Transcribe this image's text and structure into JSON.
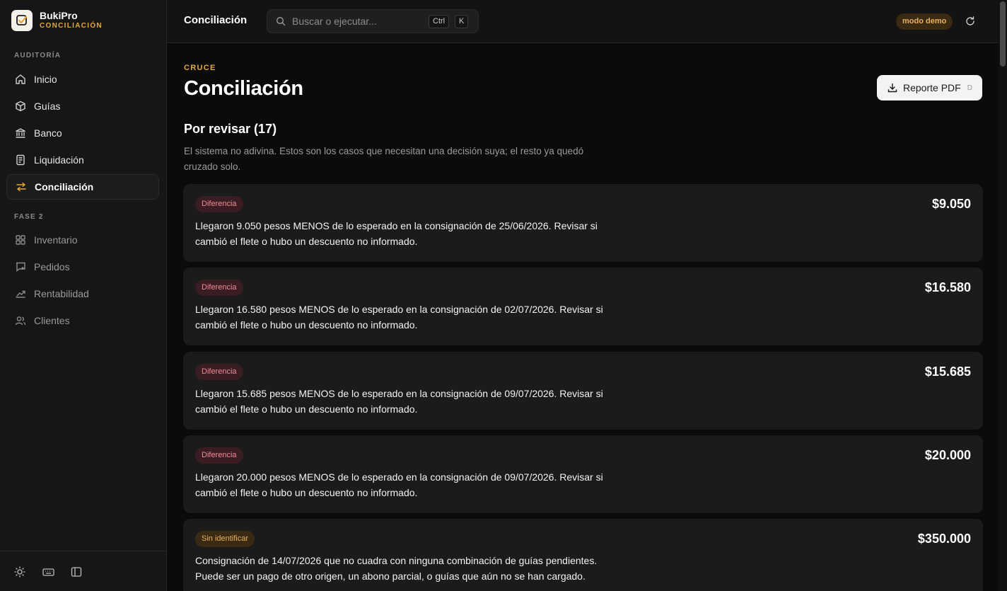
{
  "brand": {
    "name": "BukiPro",
    "subtitle": "CONCILIACIÓN"
  },
  "sidebar": {
    "sections": [
      {
        "label": "AUDITORÍA",
        "items": [
          {
            "label": "Inicio",
            "icon": "home-icon"
          },
          {
            "label": "Guías",
            "icon": "package-icon"
          },
          {
            "label": "Banco",
            "icon": "bank-icon"
          },
          {
            "label": "Liquidación",
            "icon": "receipt-icon"
          },
          {
            "label": "Conciliación",
            "icon": "arrows-exchange-icon",
            "active": true
          }
        ]
      },
      {
        "label": "FASE 2",
        "items": [
          {
            "label": "Inventario",
            "icon": "grid-icon"
          },
          {
            "label": "Pedidos",
            "icon": "cart-icon"
          },
          {
            "label": "Rentabilidad",
            "icon": "trending-up-icon"
          },
          {
            "label": "Clientes",
            "icon": "users-icon"
          }
        ]
      }
    ],
    "footer_icons": [
      "sun-icon",
      "keyboard-icon",
      "sidebar-toggle-icon"
    ]
  },
  "topbar": {
    "title": "Conciliación",
    "search_placeholder": "Buscar o ejecutar...",
    "shortcut_keys": [
      "Ctrl",
      "K"
    ],
    "demo_badge": "modo demo"
  },
  "page": {
    "eyebrow": "CRUCE",
    "title": "Conciliación",
    "pdf_button": {
      "label": "Reporte PDF",
      "shortcut": "D"
    },
    "section_title": "Por revisar (17)",
    "section_description": "El sistema no adivina. Estos son los casos que necesitan una decisión suya; el resto ya quedó cruzado solo."
  },
  "cases": [
    {
      "badge": "Diferencia",
      "kind": "diff",
      "amount": "$9.050",
      "text": "Llegaron 9.050 pesos MENOS de lo esperado en la consignación de 25/06/2026. Revisar si cambió el flete o hubo un descuento no informado."
    },
    {
      "badge": "Diferencia",
      "kind": "diff",
      "amount": "$16.580",
      "text": "Llegaron 16.580 pesos MENOS de lo esperado en la consignación de 02/07/2026. Revisar si cambió el flete o hubo un descuento no informado."
    },
    {
      "badge": "Diferencia",
      "kind": "diff",
      "amount": "$15.685",
      "text": "Llegaron 15.685 pesos MENOS de lo esperado en la consignación de 09/07/2026. Revisar si cambió el flete o hubo un descuento no informado."
    },
    {
      "badge": "Diferencia",
      "kind": "diff",
      "amount": "$20.000",
      "text": "Llegaron 20.000 pesos MENOS de lo esperado en la consignación de 09/07/2026. Revisar si cambió el flete o hubo un descuento no informado."
    },
    {
      "badge": "Sin identificar",
      "kind": "unid",
      "amount": "$350.000",
      "text": "Consignación de 14/07/2026 que no cuadra con ninguna combinación de guías pendientes. Puede ser un pago de otro origen, un abono parcial, o guías que aún no se han cargado."
    }
  ],
  "colors": {
    "accent": "#e2a93b",
    "danger_badge": "#f08a97",
    "background": "#0b0b0b"
  }
}
